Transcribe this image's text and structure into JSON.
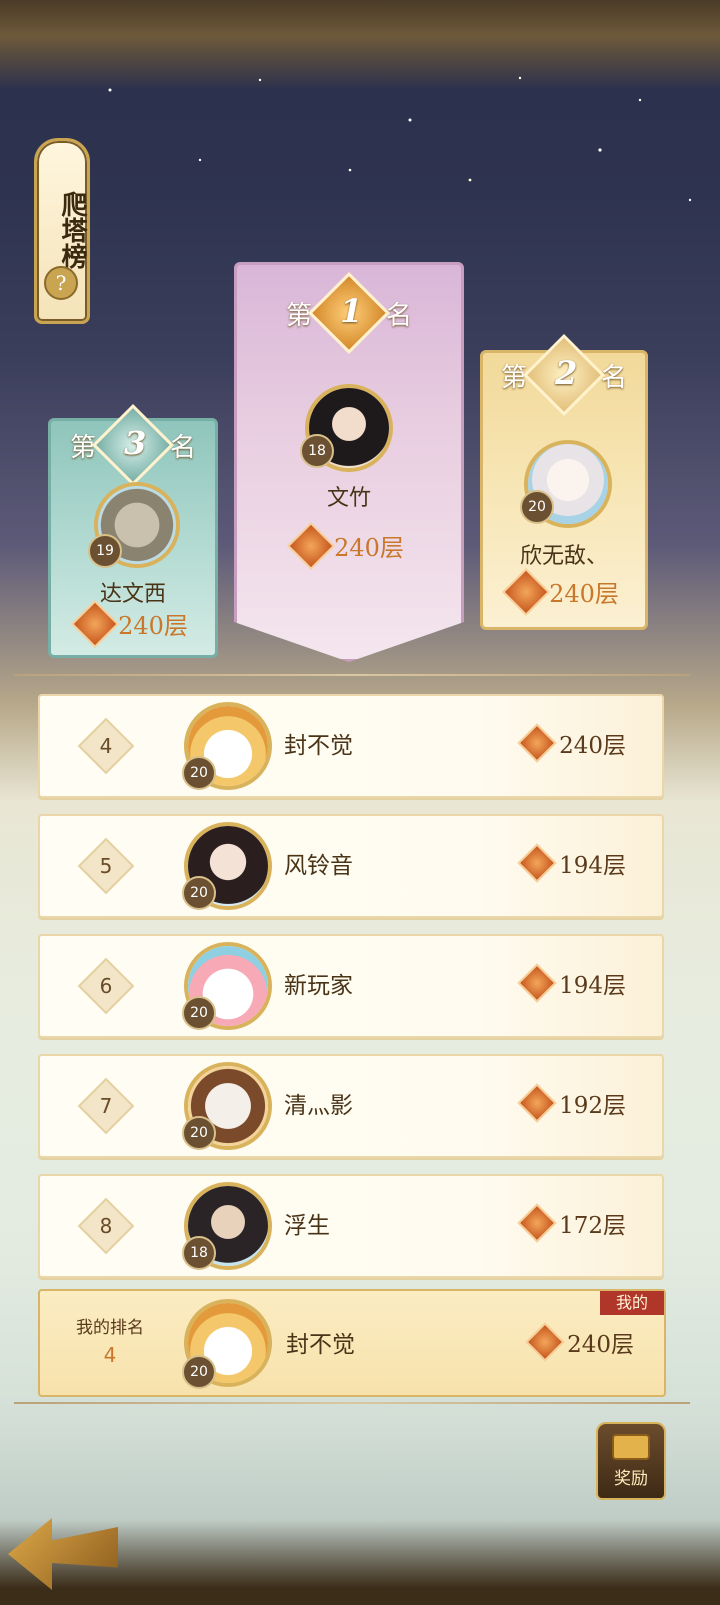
{
  "title": "爬塔榜",
  "help_icon": "?",
  "podium": {
    "first": {
      "prefix": "第",
      "rank": "1",
      "suffix": "名",
      "name": "文竹",
      "level": "18",
      "floors": "240层",
      "avatar": "dark-haired-lady"
    },
    "second": {
      "prefix": "第",
      "rank": "2",
      "suffix": "名",
      "name": "欣无敌、",
      "level": "20",
      "floors": "240层",
      "avatar": "white-haired-lady"
    },
    "third": {
      "prefix": "第",
      "rank": "3",
      "suffix": "名",
      "name": "达文西",
      "level": "19",
      "floors": "240层",
      "avatar": "stone-golem"
    }
  },
  "list": [
    {
      "rank": "4",
      "name": "封不觉",
      "level": "20",
      "floors": "240层",
      "avatar": "white-ghost"
    },
    {
      "rank": "5",
      "name": "风铃音",
      "level": "20",
      "floors": "194层",
      "avatar": "black-haired-lady"
    },
    {
      "rank": "6",
      "name": "新玩家",
      "level": "20",
      "floors": "194层",
      "avatar": "pink-ghost"
    },
    {
      "rank": "7",
      "name": "清灬影",
      "level": "20",
      "floors": "192层",
      "avatar": "white-fox"
    },
    {
      "rank": "8",
      "name": "浮生",
      "level": "18",
      "floors": "172层",
      "avatar": "scholar"
    }
  ],
  "my_rank": {
    "label": "我的排名",
    "rank": "4",
    "tag": "我的",
    "name": "封不觉",
    "level": "20",
    "floors": "240层",
    "avatar": "white-ghost"
  },
  "reward_button": {
    "label": "奖励",
    "icon": "chest-icon"
  },
  "back_button": {
    "icon": "back-arrow-icon"
  }
}
